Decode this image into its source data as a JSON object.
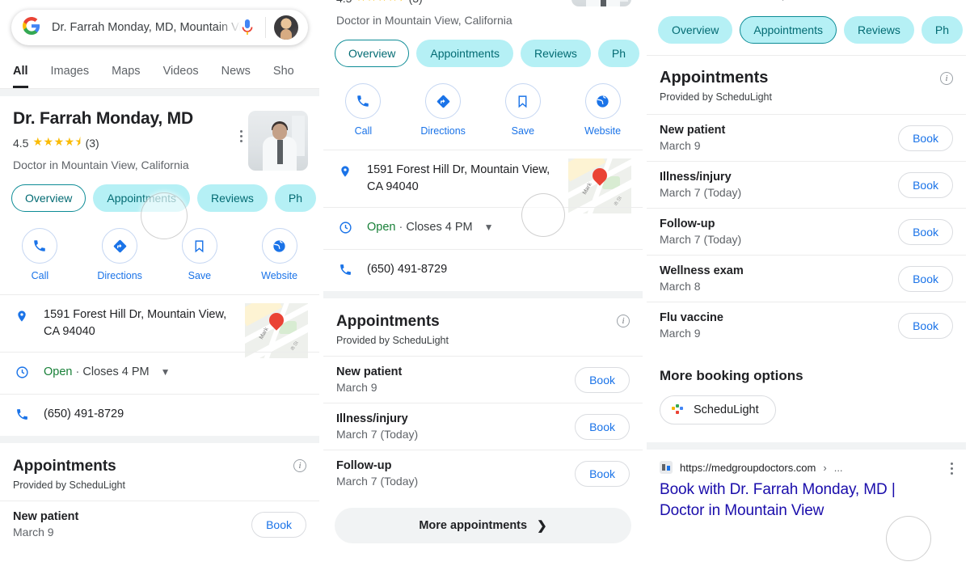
{
  "search": {
    "query": "Dr. Farrah Monday, MD, Mountain View",
    "mic_icon": "microphone-icon",
    "logo_icon": "google-logo",
    "avatar_icon": "user-avatar"
  },
  "nav_tabs": [
    {
      "label": "All",
      "active": true
    },
    {
      "label": "Images",
      "active": false
    },
    {
      "label": "Maps",
      "active": false
    },
    {
      "label": "Videos",
      "active": false
    },
    {
      "label": "News",
      "active": false
    },
    {
      "label": "Sho",
      "active": false
    }
  ],
  "knowledge_panel": {
    "title": "Dr. Farrah Monday, MD",
    "rating_value": "4.5",
    "stars": "★★★★⯨",
    "review_count": "(3)",
    "subtitle": "Doctor in Mountain View, California",
    "kebab_icon": "more-options-icon",
    "photo_icon": "doctor-photo"
  },
  "chips": [
    {
      "label": "Overview"
    },
    {
      "label": "Appointments"
    },
    {
      "label": "Reviews"
    },
    {
      "label": "Ph"
    }
  ],
  "actions": [
    {
      "label": "Call",
      "icon": "phone-icon"
    },
    {
      "label": "Directions",
      "icon": "directions-icon"
    },
    {
      "label": "Save",
      "icon": "bookmark-icon"
    },
    {
      "label": "Website",
      "icon": "globe-icon"
    }
  ],
  "info": {
    "address": "1591 Forest Hill Dr, Mountain View, CA 94040",
    "address_icon": "location-pin-icon",
    "hours_status": "Open",
    "hours_sep": "·",
    "hours_detail": "Closes 4 PM",
    "hours_icon": "clock-icon",
    "hours_caret": "chevron-down-icon",
    "phone": "(650) 491-8729",
    "phone_icon": "phone-icon",
    "map_street_1": "Mark",
    "map_street_2": "ift St"
  },
  "appointments_module": {
    "title": "Appointments",
    "provided_by": "Provided by ScheduLight",
    "info_icon": "info-icon",
    "book_label": "Book",
    "items_short": [
      {
        "name": "New patient",
        "date": "March 9"
      },
      {
        "name": "Illness/injury",
        "date": "March 7 (Today)"
      },
      {
        "name": "Follow-up",
        "date": "March 7 (Today)"
      }
    ],
    "items_full": [
      {
        "name": "New patient",
        "date": "March 9"
      },
      {
        "name": "Illness/injury",
        "date": "March 7 (Today)"
      },
      {
        "name": "Follow-up",
        "date": "March 7 (Today)"
      },
      {
        "name": "Wellness exam",
        "date": "March 8"
      },
      {
        "name": "Flu vaccine",
        "date": "March 9"
      }
    ],
    "more_label": "More appointments",
    "more_chevron": "chevron-right-icon"
  },
  "more_booking": {
    "title": "More booking options",
    "provider": "ScheduLight",
    "provider_icon": "schedulight-logo"
  },
  "organic_result": {
    "url": "https://medgroupdoctors.com",
    "url_chevron": "›",
    "url_ellipsis": "...",
    "title_line1": "Book with Dr. Farrah Monday, MD |",
    "title_line2": "Doctor in Mountain View",
    "favicon": "site-favicon",
    "kebab_icon": "more-options-icon"
  },
  "colors": {
    "chip_bg": "#b5f0f5",
    "chip_text": "#036b73",
    "chip_border_selected": "#0d8c96",
    "link_blue": "#1a73e8",
    "result_title_blue": "#1a0dab",
    "open_green": "#188038",
    "star_gold": "#fabb05",
    "pin_red": "#ea4335"
  }
}
